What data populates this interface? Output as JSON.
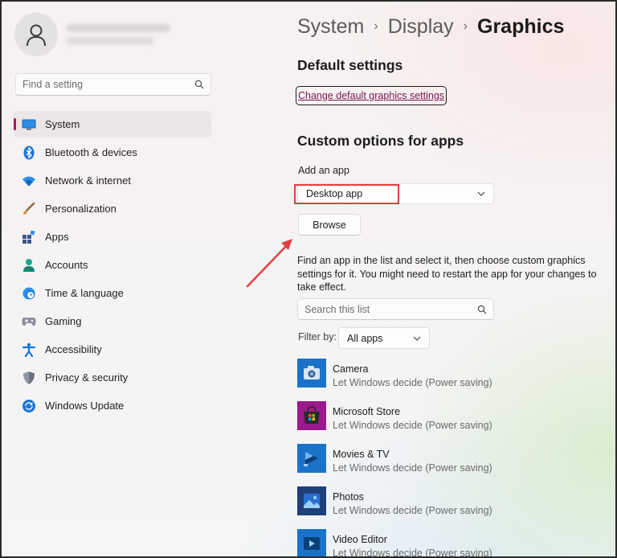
{
  "user": {
    "avatar_icon": "person-icon"
  },
  "sidebar": {
    "search_placeholder": "Find a setting",
    "items": [
      {
        "label": "System",
        "icon": "monitor-icon",
        "active": true
      },
      {
        "label": "Bluetooth & devices",
        "icon": "bluetooth-icon"
      },
      {
        "label": "Network & internet",
        "icon": "wifi-icon"
      },
      {
        "label": "Personalization",
        "icon": "brush-icon"
      },
      {
        "label": "Apps",
        "icon": "apps-icon"
      },
      {
        "label": "Accounts",
        "icon": "accounts-icon"
      },
      {
        "label": "Time & language",
        "icon": "globe-clock-icon"
      },
      {
        "label": "Gaming",
        "icon": "gamepad-icon"
      },
      {
        "label": "Accessibility",
        "icon": "accessibility-icon"
      },
      {
        "label": "Privacy & security",
        "icon": "shield-icon"
      },
      {
        "label": "Windows Update",
        "icon": "update-icon"
      }
    ]
  },
  "breadcrumb": {
    "items": [
      "System",
      "Display",
      "Graphics"
    ]
  },
  "main": {
    "default_heading": "Default settings",
    "default_link": "Change default graphics settings",
    "custom_heading": "Custom options for apps",
    "add_app_label": "Add an app",
    "add_app_selected": "Desktop app",
    "browse_label": "Browse",
    "help_text": "Find an app in the list and select it, then choose custom graphics settings for it. You might need to restart the app for your changes to take effect.",
    "list_search_placeholder": "Search this list",
    "filter_label": "Filter by:",
    "filter_value": "All apps",
    "apps": [
      {
        "name": "Camera",
        "pref": "Let Windows decide (Power saving)",
        "icon": "camera-icon"
      },
      {
        "name": "Microsoft Store",
        "pref": "Let Windows decide (Power saving)",
        "icon": "store-icon"
      },
      {
        "name": "Movies & TV",
        "pref": "Let Windows decide (Power saving)",
        "icon": "movies-icon"
      },
      {
        "name": "Photos",
        "pref": "Let Windows decide (Power saving)",
        "icon": "photos-icon"
      },
      {
        "name": "Video Editor",
        "pref": "Let Windows decide (Power saving)",
        "icon": "video-editor-icon"
      }
    ]
  },
  "colors": {
    "accent": "#b4135e",
    "link": "#7a1650",
    "annotation": "#e14040",
    "app_tile": "#1a73c8"
  }
}
